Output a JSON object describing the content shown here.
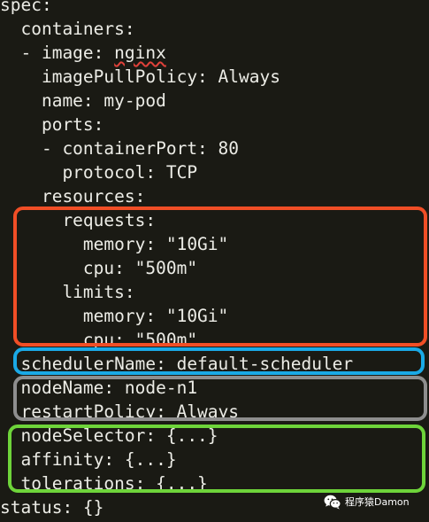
{
  "yaml": {
    "lines": [
      "spec:",
      "  containers:",
      "  - image: nginx",
      "    imagePullPolicy: Always",
      "    name: my-pod",
      "    ports:",
      "    - containerPort: 80",
      "      protocol: TCP",
      "    resources:",
      "      requests:",
      "        memory: \"10Gi\"",
      "        cpu: \"500m\"",
      "      limits:",
      "        memory: \"10Gi\"",
      "        cpu: \"500m\"",
      "  schedulerName: default-scheduler",
      "  nodeName: node-n1",
      "  restartPolicy: Always",
      "  nodeSelector: {...}",
      "  affinity: {...}",
      "  tolerations: {...}",
      "status: {}"
    ],
    "image_key": "  - image: ",
    "image_value": "nginx"
  },
  "highlights": {
    "resources_color": "#f04e26",
    "scheduler_color": "#1aa9e6",
    "node_color": "#8e8e8e",
    "selector_color": "#6ed43a"
  },
  "watermark": {
    "text": "程序猿Damon",
    "icon": "wechat-icon"
  }
}
